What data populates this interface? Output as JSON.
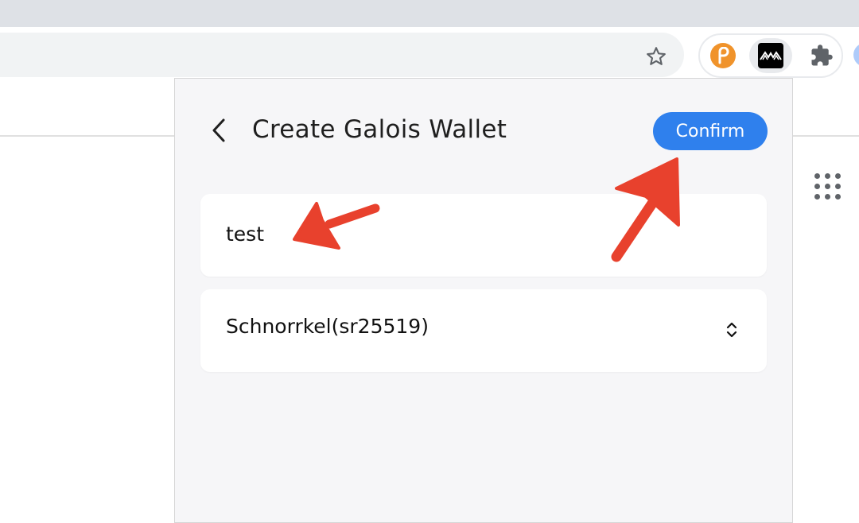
{
  "browser": {
    "bookmark_icon": "star-icon",
    "extensions": [
      {
        "name": "polkadot-extension",
        "icon": "polkadot-p-icon",
        "color": "#f0932b"
      },
      {
        "name": "galois-wallet-extension",
        "icon": "galois-logo-icon",
        "color": "#000000"
      },
      {
        "name": "extensions-menu",
        "icon": "puzzle-icon"
      }
    ],
    "apps_icon": "apps-grid-icon"
  },
  "popup": {
    "back_icon": "chevron-left-icon",
    "title": "Create Galois Wallet",
    "confirm_label": "Confirm",
    "name_field": {
      "value": "test"
    },
    "keypair_type": {
      "selected": "Schnorrkel(sr25519)",
      "icon": "select-arrows-icon"
    }
  },
  "colors": {
    "accent": "#2f80ed",
    "annotation_arrow": "#e8412d",
    "popup_bg": "#f6f6f8"
  },
  "annotations": [
    "arrow-pointing-to-name-field",
    "arrow-pointing-to-confirm-button"
  ]
}
